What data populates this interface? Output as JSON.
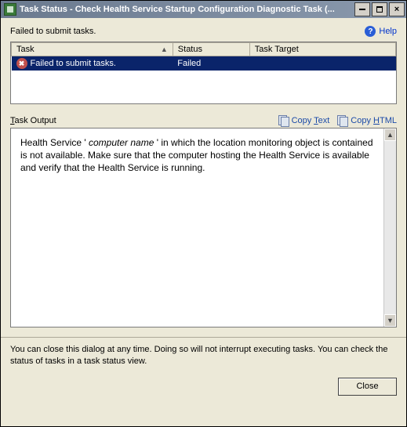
{
  "window": {
    "title": "Task Status - Check Health Service Startup Configuration Diagnostic Task (..."
  },
  "status": {
    "message": "Failed to submit tasks.",
    "help_label": "Help"
  },
  "table": {
    "columns": {
      "task": "Task",
      "status": "Status",
      "target": "Task Target"
    },
    "rows": [
      {
        "task": "Failed to submit tasks.",
        "status": "Failed",
        "target": ""
      }
    ]
  },
  "output": {
    "label_pre": "T",
    "label_rest": "ask Output",
    "copy_text_label_pre": "Copy ",
    "copy_text_label_u": "T",
    "copy_text_label_post": "ext",
    "copy_html_label_pre": "Copy ",
    "copy_html_label_u": "H",
    "copy_html_label_post": "TML",
    "msg_pre": "Health Service '  ",
    "msg_name": "computer name",
    "msg_post": "  ' in which the location monitoring object is contained is not available. Make sure that the computer hosting the Health Service is available and verify that the Health Service is running."
  },
  "footer": {
    "text": "You can close this dialog at any time.  Doing so will not interrupt executing tasks.  You can check the status of tasks in a task status view.",
    "close_label": "Close"
  }
}
